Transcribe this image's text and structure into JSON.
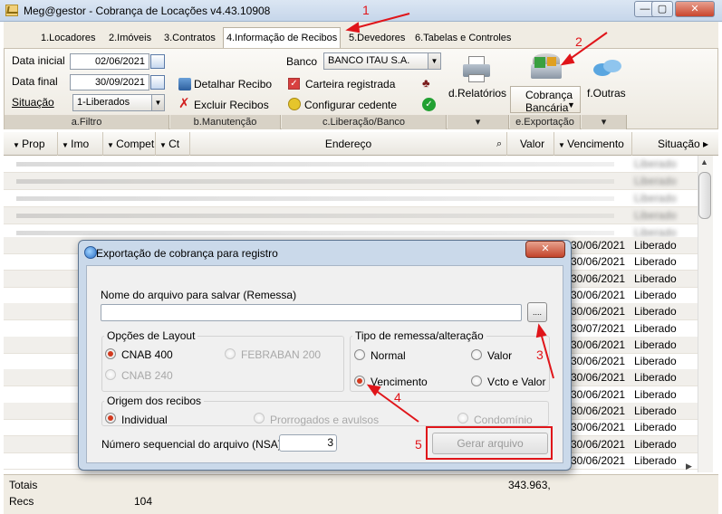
{
  "window": {
    "title": "Meg@gestor - Cobrança de Locações v4.43.10908",
    "buttons": {
      "minimize": "—",
      "maximize": "▢",
      "close": "✕"
    }
  },
  "tabs": [
    {
      "label": "1.Locadores"
    },
    {
      "label": "2.Imóveis"
    },
    {
      "label": "3.Contratos"
    },
    {
      "label": "4.Informação de Recibos"
    },
    {
      "label": "5.Devedores"
    },
    {
      "label": "6.Tabelas e Controles"
    }
  ],
  "ribbon": {
    "filtro": {
      "data_inicial_label": "Data inicial",
      "data_inicial_value": "02/06/2021",
      "data_final_label": "Data final",
      "data_final_value": "30/09/2021",
      "situacao_label": "Situação",
      "situacao_value": "1-Liberados",
      "footer": "a.Filtro"
    },
    "manutencao": {
      "detalhar": "Detalhar Recibo",
      "excluir": "Excluir Recibos",
      "footer": "b.Manutenção"
    },
    "liberacao": {
      "banco_label": "Banco",
      "banco_value": "BANCO ITAU S.A.",
      "carteira": "Carteira registrada",
      "configurar": "Configurar cedente",
      "footer": "c.Liberação/Banco"
    },
    "relatorios": {
      "label": "d.Relatórios"
    },
    "exportacao": {
      "label1": "Cobrança",
      "label2": "Bancária",
      "footer": "e.Exportação"
    },
    "outras": {
      "label": "f.Outras"
    }
  },
  "grid": {
    "columns": [
      "Prop",
      "Imo",
      "Compet",
      "Ct",
      "Endereço",
      "Valor",
      "Vencimento",
      "Situação"
    ],
    "visible_rows": [
      {
        "vencimento": "30/06/2021",
        "situacao": "Liberado"
      },
      {
        "vencimento": "30/06/2021",
        "situacao": "Liberado"
      },
      {
        "vencimento": "30/06/2021",
        "situacao": "Liberado"
      },
      {
        "vencimento": "30/06/2021",
        "situacao": "Liberado"
      },
      {
        "vencimento": "30/06/2021",
        "situacao": "Liberado"
      },
      {
        "vencimento": "30/07/2021",
        "situacao": "Liberado"
      },
      {
        "vencimento": "30/06/2021",
        "situacao": "Liberado"
      },
      {
        "vencimento": "30/06/2021",
        "situacao": "Liberado"
      },
      {
        "vencimento": "30/06/2021",
        "situacao": "Liberado"
      },
      {
        "vencimento": "30/06/2021",
        "situacao": "Liberado"
      },
      {
        "vencimento": "30/06/2021",
        "situacao": "Liberado"
      },
      {
        "vencimento": "30/06/2021",
        "situacao": "Liberado"
      },
      {
        "vencimento": "30/06/2021",
        "situacao": "Liberado"
      },
      {
        "vencimento": "30/06/2021",
        "situacao": "Liberado"
      }
    ],
    "blurred_situacao": "Liberado"
  },
  "totals": {
    "totais_label": "Totais",
    "recs_label": "Recs",
    "recs_value": "104",
    "valor_total": "343.963,"
  },
  "modal": {
    "title": "Exportação de cobrança para registro",
    "close": "✕",
    "file_label": "Nome do arquivo para salvar (Remessa)",
    "file_value": "",
    "browse": "....",
    "layout": {
      "legend": "Opções de Layout",
      "options": [
        "CNAB 400",
        "FEBRABAN 200",
        "CNAB 240"
      ]
    },
    "tipo": {
      "legend": "Tipo de remessa/alteração",
      "options": [
        "Normal",
        "Valor",
        "Vencimento",
        "Vcto e Valor"
      ]
    },
    "origem": {
      "legend": "Origem dos recibos",
      "options": [
        "Individual",
        "Prorrogados e avulsos",
        "Condomínio"
      ]
    },
    "nsa_label": "Número sequencial do arquivo (NSA):",
    "nsa_value": "3",
    "generate": "Gerar arquivo"
  },
  "annotations": {
    "n1": "1",
    "n2": "2",
    "n3": "3",
    "n4": "4",
    "n5": "5"
  },
  "colors": {
    "annotation_red": "#e0151a",
    "radio_selected": "#d23a1f"
  }
}
